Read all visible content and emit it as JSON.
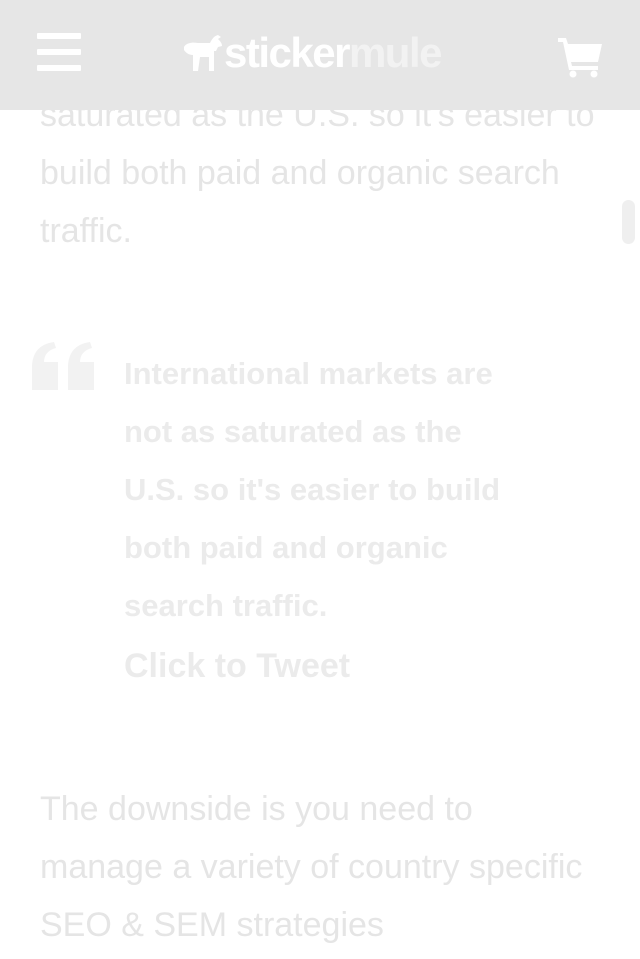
{
  "header": {
    "logo_primary": "sticker",
    "logo_secondary": "mule",
    "menu_icon": "hamburger-menu-icon",
    "cart_icon": "shopping-cart-icon"
  },
  "article": {
    "paragraph_top": "saturated as the U.S. so it's easier to build both paid and organic search traffic.",
    "quote": "International markets are not as saturated as the U.S. so it's easier to build both paid and organic search traffic.",
    "quote_icon": "quote-mark-icon",
    "tweet_link": "Click to Tweet",
    "paragraph_bottom": "The downside is you need to manage a variety of country specific SEO & SEM strategies"
  },
  "colors": {
    "header_bg": "#e6e6e6",
    "text": "#e5e5e5",
    "icon": "#ffffff"
  }
}
